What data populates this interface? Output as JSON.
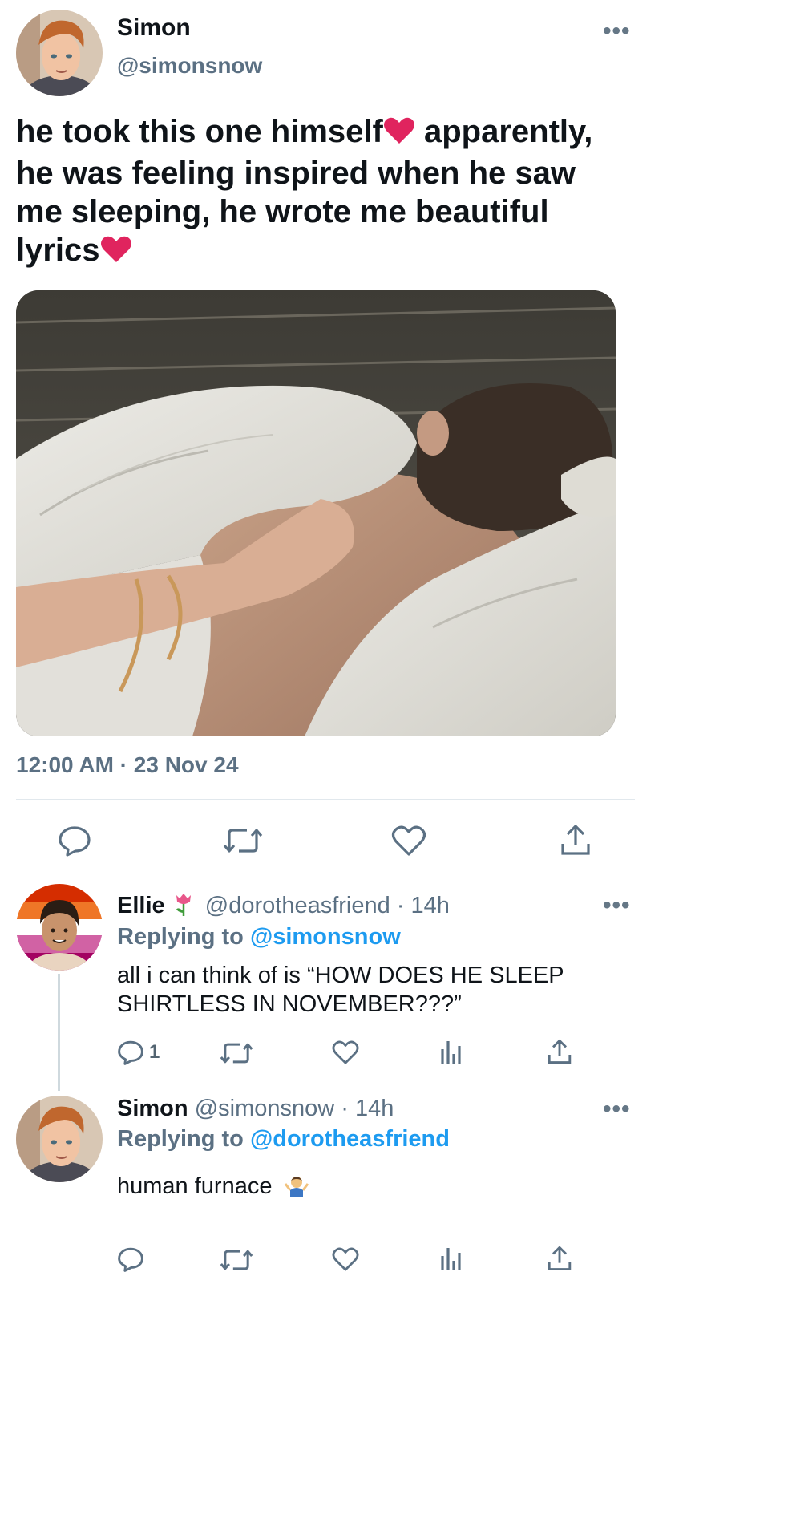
{
  "main_tweet": {
    "author_name": "Simon",
    "author_handle": "@simonsnow",
    "text_line1_a": "he took this one himself",
    "text_line1_b": " apparently,",
    "text_line2": "he was feeling inspired when he saw",
    "text_line3": "me sleeping, he wrote me beautiful",
    "text_line4": "lyrics",
    "timestamp": "12:00 AM · 23 Nov 24"
  },
  "reply1": {
    "author_name": "Ellie",
    "author_handle_time": "@dorotheasfriend · 14h",
    "replying_label": "Replying to",
    "replying_handle": "@simonsnow",
    "text_line1": "all i can think of is “HOW DOES HE SLEEP",
    "text_line2": "SHIRTLESS IN NOVEMBER???”",
    "reply_count": "1"
  },
  "reply2": {
    "author_name": "Simon",
    "author_handle_time": "@simonsnow · 14h",
    "replying_label": "Replying to",
    "replying_handle": "@dorotheasfriend",
    "text": "human furnace"
  },
  "colors": {
    "link": "#1d9bf0",
    "muted": "#5b7083",
    "heart": "#e0245e"
  },
  "icons": [
    "more-icon",
    "reply-icon",
    "retweet-icon",
    "like-icon",
    "share-icon",
    "analytics-icon",
    "heart-emoji-icon",
    "tulip-emoji-icon",
    "shrug-emoji-icon"
  ]
}
